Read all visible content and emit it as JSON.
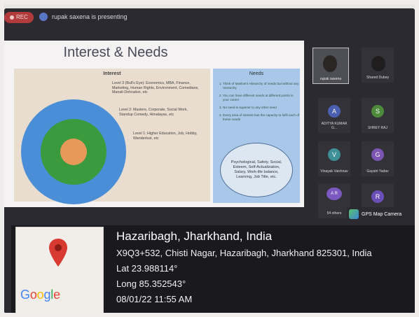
{
  "meeting": {
    "rec_label": "REC",
    "presenter_text": "rupak saxena is presenting"
  },
  "slide": {
    "title": "Interest & Needs",
    "interest_heading": "Interest",
    "levels": [
      "Level 3 (Bull's Eye): Economics, MBA, Finance, Marketing, Human Rights, Environment, Comedians, Manali-Dehradun, etc",
      "Level 2: Masters, Corporate, Social Work, Standup Comedy, Himalayas, etc",
      "Level 1: Higher Education, Job, Hobby, Wanderlust, etc"
    ],
    "needs_heading": "Needs",
    "needs_points": [
      "Think of Maslow's Hierarchy of needs but without any Hierarchy",
      "You can have different needs at different points in your career",
      "No need is superior to any other need",
      "Every area of interest has the capacity to fulfil each of these needs"
    ],
    "needs_oval": "Psychological, Safety, Social, Esteem, Self-Actualization, Salary, Work-life balance, Learning, Job Title, etc."
  },
  "participants": [
    {
      "name": "rupak saxena",
      "initial": "",
      "color": "#4e4e55"
    },
    {
      "name": "Shared Dubey",
      "initial": "",
      "color": "#323238"
    },
    {
      "name": "ADITYA KUMAR G...",
      "initial": "A",
      "color": "#4a5fb0"
    },
    {
      "name": "SHREY RAJ",
      "initial": "S",
      "color": "#4d8a3c"
    },
    {
      "name": "Vinayak Vaishnav",
      "initial": "V",
      "color": "#3f8f98"
    },
    {
      "name": "Gayatri Yadav",
      "initial": "G",
      "color": "#7c54b2"
    },
    {
      "name": "54 others",
      "initial": "A R",
      "color": "#7b59c0"
    },
    {
      "name": "",
      "initial": "R",
      "color": "#6b4fb8"
    }
  ],
  "gps": {
    "chip_label": "GPS Map Camera",
    "title": "Hazaribagh, Jharkhand, India",
    "address": "X9Q3+532, Chisti Nagar, Hazaribagh, Jharkhand 825301, India",
    "lat": "Lat 23.988114°",
    "long": "Long 85.352543°",
    "datetime": "08/01/22 11:55 AM",
    "map_brand": "Google"
  }
}
